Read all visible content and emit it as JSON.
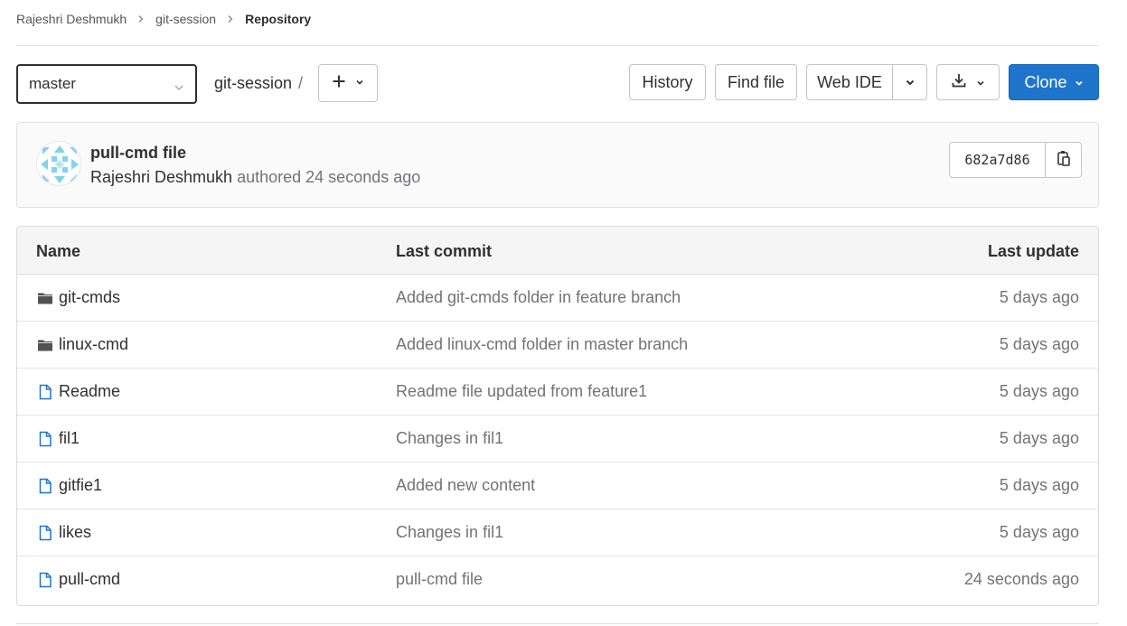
{
  "breadcrumb": {
    "items": [
      "Rajeshri Deshmukh",
      "git-session",
      "Repository"
    ]
  },
  "toolbar": {
    "branch": "master",
    "path": "git-session",
    "path_separator": "/",
    "history_label": "History",
    "find_file_label": "Find file",
    "web_ide_label": "Web IDE",
    "clone_label": "Clone"
  },
  "commit": {
    "title": "pull-cmd file",
    "author": "Rajeshri Deshmukh",
    "action": "authored",
    "time": "24 seconds ago",
    "sha": "682a7d86"
  },
  "table": {
    "headers": {
      "name": "Name",
      "last_commit": "Last commit",
      "last_update": "Last update"
    },
    "rows": [
      {
        "name": "git-cmds",
        "type": "folder",
        "commit": "Added git-cmds folder in feature branch",
        "updated": "5 days ago"
      },
      {
        "name": "linux-cmd",
        "type": "folder",
        "commit": "Added linux-cmd folder in master branch",
        "updated": "5 days ago"
      },
      {
        "name": "Readme",
        "type": "file",
        "commit": "Readme file updated from feature1",
        "updated": "5 days ago"
      },
      {
        "name": "fil1",
        "type": "file",
        "commit": "Changes in fil1",
        "updated": "5 days ago"
      },
      {
        "name": "gitfie1",
        "type": "file",
        "commit": "Added new content",
        "updated": "5 days ago"
      },
      {
        "name": "likes",
        "type": "file",
        "commit": "Changes in fil1",
        "updated": "5 days ago"
      },
      {
        "name": "pull-cmd",
        "type": "file",
        "commit": "pull-cmd file",
        "updated": "24 seconds ago"
      }
    ]
  },
  "colors": {
    "primary": "#1f75cb",
    "file_icon": "#1f75cb",
    "folder_icon": "#525252",
    "muted_text": "#737278"
  },
  "icons": {
    "folder": "folder-icon",
    "file": "file-icon",
    "copy": "copy-icon",
    "download": "download-icon",
    "plus": "plus-icon",
    "chevron": "chevron-down-icon"
  }
}
